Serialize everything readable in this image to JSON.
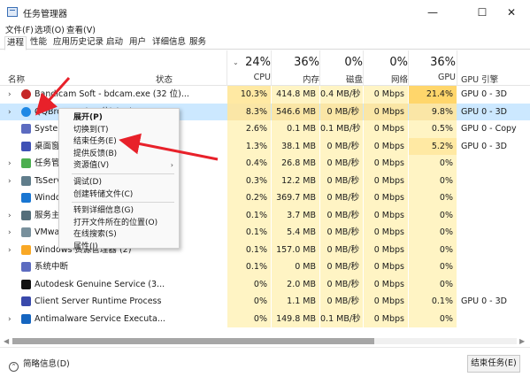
{
  "window": {
    "title": "任务管理器"
  },
  "menu": [
    "文件(F)",
    "选项(O)",
    "查看(V)"
  ],
  "tabs": [
    "进程",
    "性能",
    "应用历史记录",
    "启动",
    "用户",
    "详细信息",
    "服务"
  ],
  "header": {
    "name": "名称",
    "status": "状态",
    "cpu": {
      "pct": "24%",
      "label": "CPU"
    },
    "memory": {
      "pct": "36%",
      "label": "内存"
    },
    "disk": {
      "pct": "0%",
      "label": "磁盘"
    },
    "network": {
      "pct": "0%",
      "label": "网络"
    },
    "gpu": {
      "pct": "36%",
      "label": "GPU"
    },
    "gpu_engine": {
      "label": "GPU 引擎"
    }
  },
  "rows": [
    {
      "name": "Bandicam Soft - bdcam.exe (32 位)...",
      "icon": "bandicam-icon",
      "expand": true,
      "cpu": "10.3%",
      "mem": "414.8 MB",
      "disk": "0.4 MB/秒",
      "net": "0 Mbps",
      "gpu": "21.4%",
      "engine": "GPU 0 - 3D"
    },
    {
      "name": "QQBrowser (32 位) (12)",
      "icon": "qqbrowser-icon",
      "expand": true,
      "selected": true,
      "cpu": "8.3%",
      "mem": "546.6 MB",
      "disk": "0 MB/秒",
      "net": "0 Mbps",
      "gpu": "9.8%",
      "engine": "GPU 0 - 3D"
    },
    {
      "name": "System",
      "icon": "system-icon",
      "expand": false,
      "cpu": "2.6%",
      "mem": "0.1 MB",
      "disk": "0.1 MB/秒",
      "net": "0 Mbps",
      "gpu": "0.5%",
      "engine": "GPU 0 - Copy"
    },
    {
      "name": "桌面窗口管理器",
      "icon": "dwm-icon",
      "expand": false,
      "cpu": "1.3%",
      "mem": "38.1 MB",
      "disk": "0 MB/秒",
      "net": "0 Mbps",
      "gpu": "5.2%",
      "engine": "GPU 0 - 3D"
    },
    {
      "name": "任务管理器",
      "icon": "taskmgr-icon",
      "expand": true,
      "cpu": "0.4%",
      "mem": "26.8 MB",
      "disk": "0 MB/秒",
      "net": "0 Mbps",
      "gpu": "0%",
      "engine": ""
    },
    {
      "name": "TsService",
      "icon": "service-icon",
      "expand": true,
      "cpu": "0.3%",
      "mem": "12.2 MB",
      "disk": "0 MB/秒",
      "net": "0 Mbps",
      "gpu": "0%",
      "engine": ""
    },
    {
      "name": "Windows",
      "icon": "windows-icon",
      "expand": false,
      "cpu": "0.2%",
      "mem": "369.7 MB",
      "disk": "0 MB/秒",
      "net": "0 Mbps",
      "gpu": "0%",
      "engine": ""
    },
    {
      "name": "服务主机",
      "icon": "gear-icon",
      "expand": true,
      "cpu": "0.1%",
      "mem": "3.7 MB",
      "disk": "0 MB/秒",
      "net": "0 Mbps",
      "gpu": "0%",
      "engine": ""
    },
    {
      "name": "VMware",
      "icon": "vmware-icon",
      "expand": true,
      "cpu": "0.1%",
      "mem": "5.4 MB",
      "disk": "0 MB/秒",
      "net": "0 Mbps",
      "gpu": "0%",
      "engine": ""
    },
    {
      "name": "Windows 资源管理器 (2)",
      "icon": "explorer-icon",
      "expand": true,
      "cpu": "0.1%",
      "mem": "157.0 MB",
      "disk": "0 MB/秒",
      "net": "0 Mbps",
      "gpu": "0%",
      "engine": ""
    },
    {
      "name": "系统中断",
      "icon": "interrupt-icon",
      "expand": false,
      "cpu": "0.1%",
      "mem": "0 MB",
      "disk": "0 MB/秒",
      "net": "0 Mbps",
      "gpu": "0%",
      "engine": ""
    },
    {
      "name": "Autodesk Genuine Service (3...",
      "icon": "autodesk-icon",
      "expand": false,
      "cpu": "0%",
      "mem": "2.0 MB",
      "disk": "0 MB/秒",
      "net": "0 Mbps",
      "gpu": "0%",
      "engine": ""
    },
    {
      "name": "Client Server Runtime Process",
      "icon": "csrss-icon",
      "expand": false,
      "cpu": "0%",
      "mem": "1.1 MB",
      "disk": "0 MB/秒",
      "net": "0 Mbps",
      "gpu": "0.1%",
      "engine": "GPU 0 - 3D"
    },
    {
      "name": "Antimalware Service Executa...",
      "icon": "defender-icon",
      "expand": true,
      "cpu": "0%",
      "mem": "149.8 MB",
      "disk": "0.1 MB/秒",
      "net": "0 Mbps",
      "gpu": "0%",
      "engine": ""
    }
  ],
  "context_menu": [
    {
      "label": "展开(P)",
      "bold": true
    },
    {
      "label": "切换到(T)"
    },
    {
      "label": "结束任务(E)"
    },
    {
      "label": "提供反馈(B)"
    },
    {
      "label": "资源值(V)",
      "submenu": true
    },
    {
      "sep": true
    },
    {
      "label": "调试(D)"
    },
    {
      "label": "创建转储文件(C)"
    },
    {
      "sep": true
    },
    {
      "label": "转到详细信息(G)"
    },
    {
      "label": "打开文件所在的位置(O)"
    },
    {
      "label": "在线搜索(S)"
    },
    {
      "label": "属性(I)"
    }
  ],
  "footer": {
    "fewer_details": "简略信息(D)",
    "end_task": "结束任务(E)"
  },
  "colors": {
    "selected_row": "#cce8ff",
    "heat_light": "#fff4c4",
    "heat_mid": "#ffe9a3",
    "heat_high": "#ffd66b",
    "annotation": "#e8212a"
  }
}
